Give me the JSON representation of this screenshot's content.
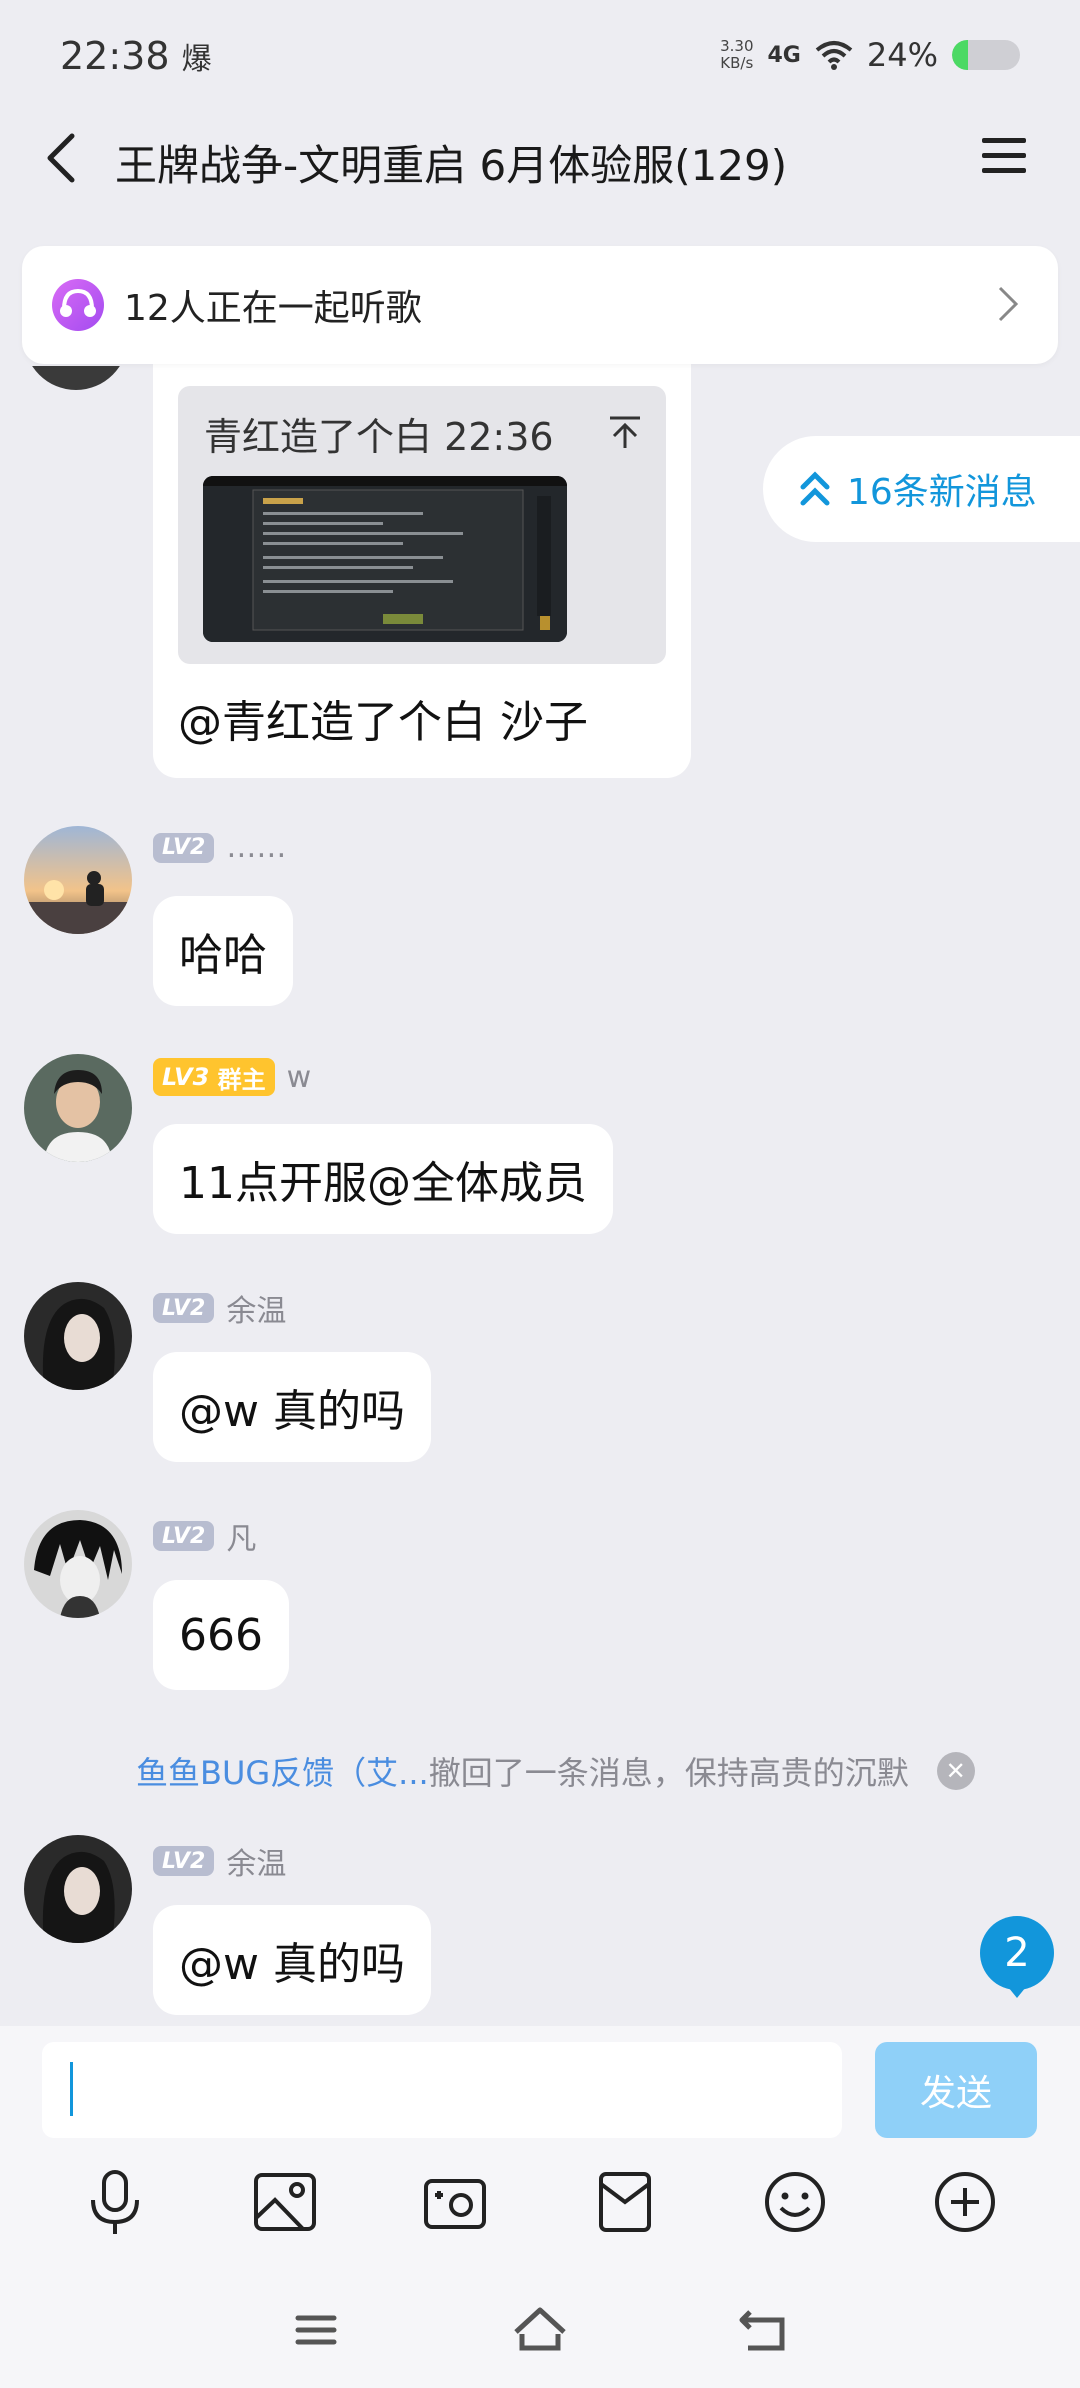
{
  "status_bar": {
    "time": "22:38",
    "extra": "爆",
    "net_speed_value": "3.30",
    "net_speed_unit": "KB/s",
    "network": "4G",
    "battery_percent": "24%",
    "battery_level": 0.24
  },
  "header": {
    "title": "王牌战争-文明重启 6月体验服(129)"
  },
  "listen_banner": {
    "text": "12人正在一起听歌"
  },
  "new_messages": {
    "label": "16条新消息"
  },
  "reply_message": {
    "quote_header": "青红造了个白 22:36",
    "text": "@青红造了个白 沙子"
  },
  "messages": [
    {
      "level": "LV2",
      "role": "",
      "sender": "……",
      "text": "哈哈"
    },
    {
      "level": "LV3",
      "role": "群主",
      "sender": "w",
      "text": "11点开服@全体成员"
    },
    {
      "level": "LV2",
      "role": "",
      "sender": "余温",
      "text": "@w 真的吗"
    },
    {
      "level": "LV2",
      "role": "",
      "sender": "凡",
      "text": "666"
    },
    {
      "level": "LV2",
      "role": "",
      "sender": "余温",
      "text": "@w 真的吗"
    }
  ],
  "recall_notice": {
    "name": "鱼鱼BUG反馈（艾...",
    "text": "撤回了一条消息，保持高贵的沉默"
  },
  "unread_badge": "2",
  "input": {
    "value": "",
    "send_label": "发送"
  },
  "toolbar": [
    "microphone-icon",
    "image-icon",
    "camera-icon",
    "red-packet-icon",
    "emoji-icon",
    "add-icon"
  ],
  "colors": {
    "accent": "#1296db",
    "background": "#EDEDF2",
    "owner_badge": "#ffc42e",
    "level_badge": "#b8bdd0",
    "send_disabled": "#8fd0f8"
  }
}
